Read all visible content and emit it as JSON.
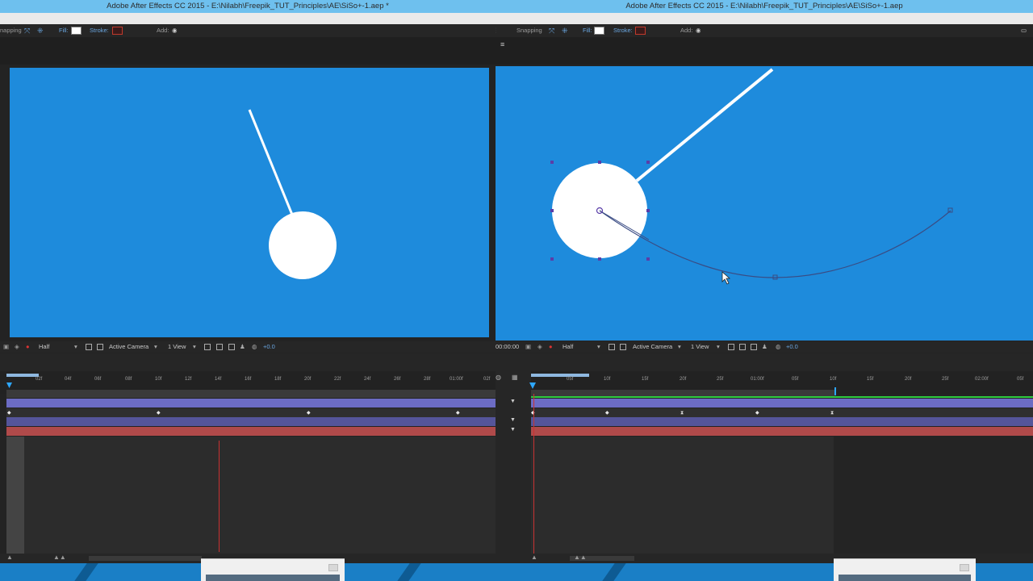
{
  "left_window": {
    "title": "Adobe After Effects CC 2015 - E:\\Nilabh\\Freepik_TUT_Principles\\AE\\SiSo+-1.aep *",
    "toolbar": {
      "snapping_label": "napping",
      "fill_label": "Fill:",
      "stroke_label": "Stroke:",
      "add_label": "Add:"
    },
    "viewer_bar": {
      "resolution": "Half",
      "camera": "Active Camera",
      "views": "1 View",
      "exposure": "+0.0"
    },
    "ruler_labels": [
      "02f",
      "04f",
      "06f",
      "08f",
      "10f",
      "12f",
      "14f",
      "16f",
      "18f",
      "20f",
      "22f",
      "24f",
      "26f",
      "28f",
      "01:00f",
      "02f"
    ]
  },
  "right_window": {
    "title": "Adobe After Effects CC 2015 - E:\\Nilabh\\Freepik_TUT_Principles\\AE\\SiSo+-1.aep",
    "toolbar": {
      "snapping_label": "Snapping",
      "fill_label": "Fill:",
      "stroke_label": "Stroke:",
      "add_label": "Add:"
    },
    "panel_menu_glyph": "≡",
    "viewer_bar": {
      "timecode": "00:00:00",
      "resolution": "Half",
      "camera": "Active Camera",
      "views": "1 View",
      "exposure": "+0.0"
    },
    "ruler_labels": [
      "05f",
      "10f",
      "15f",
      "20f",
      "25f",
      "01:00f",
      "05f",
      "10f",
      "15f",
      "20f",
      "25f",
      "02:00f",
      "05f"
    ]
  },
  "colors": {
    "comp_background": "#1e8bdc",
    "title_bar": "#6ec0ee",
    "layer_purple": "#6c6cc4",
    "layer_red": "#b04a4a",
    "playhead": "#c83232",
    "motion_path": "#3a4c84"
  },
  "icons": [
    "snapping-icon",
    "fill-swatch",
    "stroke-swatch",
    "add-icon",
    "camera-dropdown-icon",
    "keyframe-icon",
    "playhead-icon",
    "cursor-icon"
  ]
}
